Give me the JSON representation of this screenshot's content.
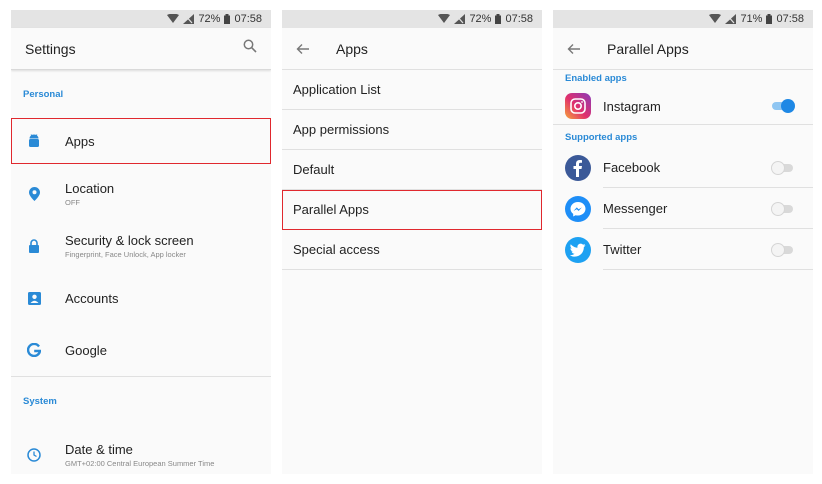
{
  "colors": {
    "accent": "#2a8ad6",
    "highlight": "#e0282e",
    "toggle_on": "#1e88e5"
  },
  "panel1": {
    "status": {
      "battery": "72%",
      "time": "07:58"
    },
    "title": "Settings",
    "sections": {
      "personal": "Personal",
      "system": "System"
    },
    "items": [
      {
        "label": "Apps",
        "sub": "",
        "icon": "android-icon"
      },
      {
        "label": "Location",
        "sub": "OFF",
        "icon": "location-pin-icon"
      },
      {
        "label": "Security & lock screen",
        "sub": "Fingerprint, Face Unlock, App locker",
        "icon": "lock-icon"
      },
      {
        "label": "Accounts",
        "sub": "",
        "icon": "account-icon"
      },
      {
        "label": "Google",
        "sub": "",
        "icon": "google-icon"
      }
    ],
    "system_items": [
      {
        "label": "Date & time",
        "sub": "GMT+02:00 Central European Summer Time",
        "icon": "clock-icon"
      }
    ]
  },
  "panel2": {
    "status": {
      "battery": "72%",
      "time": "07:58"
    },
    "title": "Apps",
    "items": [
      "Application List",
      "App permissions",
      "Default",
      "Parallel Apps",
      "Special access"
    ]
  },
  "panel3": {
    "status": {
      "battery": "71%",
      "time": "07:58"
    },
    "title": "Parallel Apps",
    "enabled_header": "Enabled apps",
    "supported_header": "Supported apps",
    "enabled": [
      {
        "name": "Instagram",
        "on": true,
        "icon": "instagram-icon"
      }
    ],
    "supported": [
      {
        "name": "Facebook",
        "on": false,
        "icon": "facebook-icon"
      },
      {
        "name": "Messenger",
        "on": false,
        "icon": "messenger-icon"
      },
      {
        "name": "Twitter",
        "on": false,
        "icon": "twitter-icon"
      }
    ]
  }
}
